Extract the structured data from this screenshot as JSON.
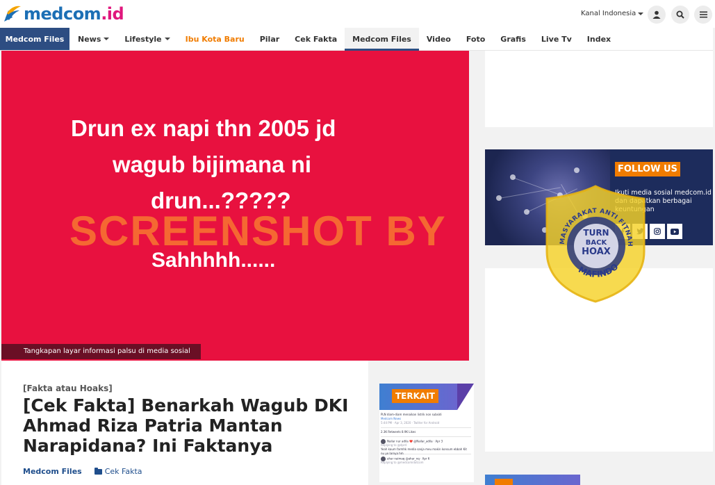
{
  "header": {
    "logo": {
      "main": "medcom",
      "suffix": ".id"
    },
    "kanal_label": "Kanal Indonesia",
    "icons": [
      "user-icon",
      "search-icon",
      "menu-icon"
    ]
  },
  "nav": {
    "brand": "Medcom Files",
    "items": [
      {
        "label": "News",
        "dropdown": true
      },
      {
        "label": "Lifestyle",
        "dropdown": true
      },
      {
        "label": "Ibu Kota Baru",
        "highlight": true
      },
      {
        "label": "Pilar"
      },
      {
        "label": "Cek Fakta"
      },
      {
        "label": "Medcom Files",
        "active": true
      },
      {
        "label": "Video"
      },
      {
        "label": "Foto"
      },
      {
        "label": "Grafis"
      },
      {
        "label": "Live Tv"
      },
      {
        "label": "Index"
      }
    ]
  },
  "hero": {
    "lines": [
      "Drun ex napi thn 2005 jd",
      "wagub bijimana ni",
      "drun...?????",
      "Sahhhhh......"
    ],
    "watermark": "SCREENSHOT BY",
    "caption": "Tangkapan layar informasi palsu di media sosial"
  },
  "badge": {
    "top_text": "MASYARAKAT ANTI FITNAH INDONESIA",
    "center_lines": [
      "TURN",
      "BACK",
      "HOAX"
    ],
    "bottom_text": "MAFINDO"
  },
  "article": {
    "category": "[Fakta atau Hoaks]",
    "title": "[Cek Fakta] Benarkah Wagub DKI Ahmad Riza Patria Mantan Narapidana? Ini Faktanya",
    "author": "Medcom Files",
    "section": "Cek Fakta"
  },
  "related": {
    "label": "TERKAIT",
    "tweet": {
      "headline": "PLN diam-diam menaikan listrik non subsidi",
      "source": "Medcom News",
      "time": "5:44 PM · Apr 3, 2020 · Twitter for Android",
      "stats": "2.3K Retweets   8.9K Likes",
      "reply1_user": "Nailar nur adila ❤️ @Nailar_adila · Apr 3",
      "reply1_to": "Replying to @dprd",
      "reply1_text": "Yeah kaum farmhk media sanja meu makin konsum ebbah Kit nu yo Iarnya hm",
      "reply2_user": "ahar naimaq @ahar_nq · Apr 6",
      "reply2_to": "Replying to @medcomidotcom"
    }
  },
  "follow": {
    "label": "FOLLOW US",
    "text": "Ikuti media sosial medcom.id dan dapatkan berbagai keuntungan",
    "networks": [
      "facebook-icon",
      "twitter-icon",
      "instagram-icon",
      "youtube-icon"
    ]
  },
  "colors": {
    "brand_blue": "#2d4d82",
    "accent_orange": "#f07c00",
    "hero_red": "#e8113f",
    "logo_blue": "#1c6fb5",
    "logo_pink": "#e0177d"
  }
}
